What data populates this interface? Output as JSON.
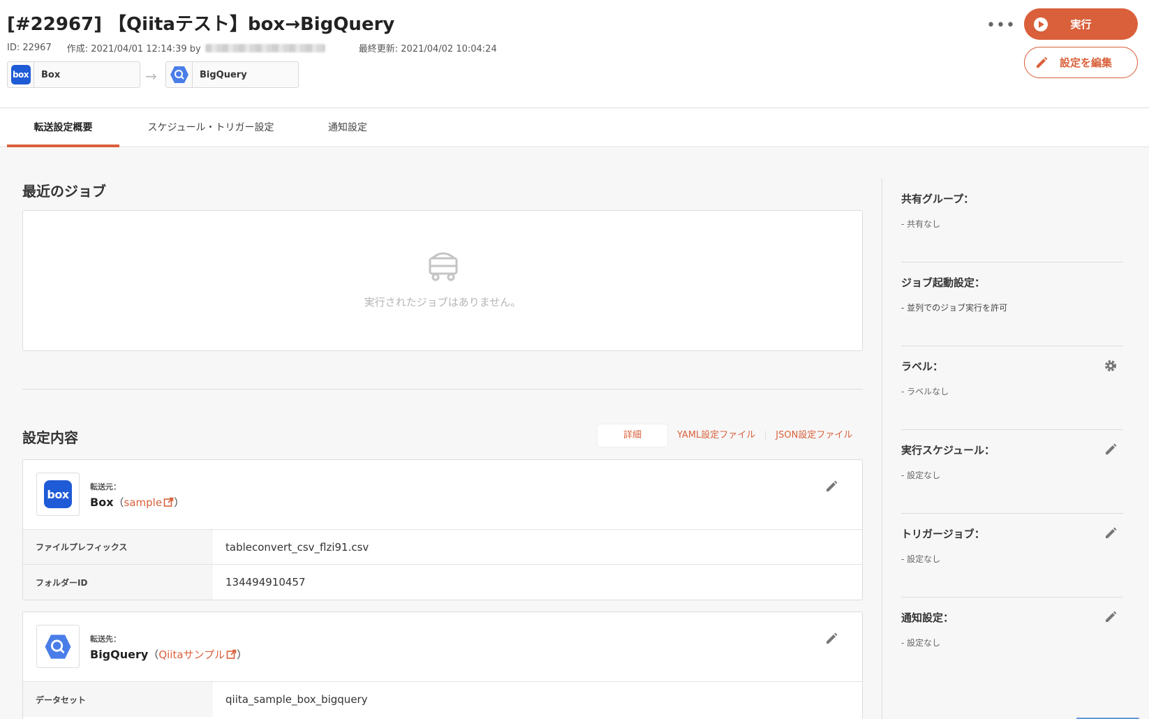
{
  "header": {
    "title": "[#22967] 【Qiitaテスト】box→BigQuery",
    "id_text": "ID: 22967",
    "created_text": "作成: 2021/04/01 12:14:39 by",
    "updated_text": "最終更新: 2021/04/02 10:04:24",
    "source_connector": "Box",
    "dest_connector": "BigQuery",
    "box_logo_text": "box",
    "more_label": "•••",
    "run_label": "実行",
    "edit_label": "設定を編集"
  },
  "tabs": [
    {
      "label": "転送設定概要",
      "active": true
    },
    {
      "label": "スケジュール・トリガー設定",
      "active": false
    },
    {
      "label": "通知設定",
      "active": false
    }
  ],
  "recent_jobs": {
    "title": "最近のジョブ",
    "empty_text": "実行されたジョブはありません。"
  },
  "settings": {
    "title": "設定内容",
    "view_tabs": [
      {
        "label": "詳細",
        "active": true
      },
      {
        "label": "YAML設定ファイル",
        "active": false
      },
      {
        "label": "JSON設定ファイル",
        "active": false
      }
    ],
    "source": {
      "role": "転送元：",
      "service": "Box",
      "paren_open": "（",
      "link": "sample",
      "paren_close": "）",
      "logo_text": "box",
      "rows": [
        {
          "key": "ファイルプレフィックス",
          "value": "tableconvert_csv_flzi91.csv"
        },
        {
          "key": "フォルダーID",
          "value": "134494910457"
        }
      ]
    },
    "dest": {
      "role": "転送先：",
      "service": "BigQuery",
      "paren_open": "（",
      "link": "Qiitaサンプル",
      "paren_close": "）",
      "rows": [
        {
          "key": "データセット",
          "value": "qiita_sample_box_bigquery"
        }
      ]
    }
  },
  "sidebar": {
    "sections": [
      {
        "title": "共有グループ：",
        "value": "- 共有なし"
      },
      {
        "title": "ジョブ起動設定：",
        "value": "- 並列でのジョブ実行を許可"
      },
      {
        "title": "ラベル：",
        "value": "- ラベルなし"
      },
      {
        "title": "実行スケジュール：",
        "value": "- 設定なし"
      },
      {
        "title": "トリガージョブ：",
        "value": "- 設定なし"
      },
      {
        "title": "通知設定：",
        "value": "- 設定なし"
      }
    ]
  },
  "colors": {
    "accent": "#d9603b",
    "box_blue": "#1f5bd6",
    "bigquery_blue": "#4a7de8"
  }
}
